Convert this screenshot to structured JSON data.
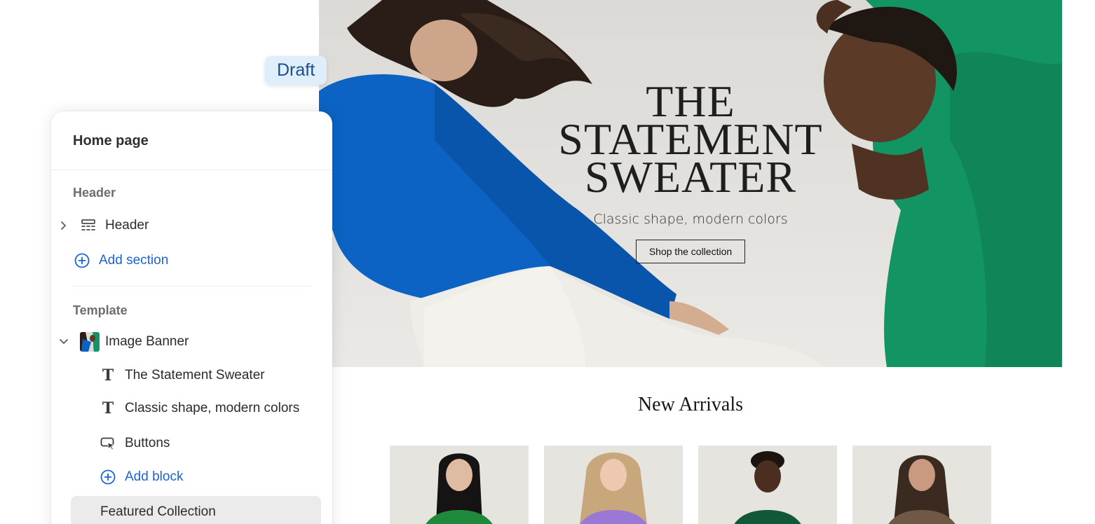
{
  "editor": {
    "status_badge": "Draft",
    "panel_title": "Home page",
    "header_group": {
      "label": "Header",
      "section_label": "Header",
      "add_section_label": "Add section"
    },
    "template_group": {
      "label": "Template",
      "section_label": "Image Banner",
      "blocks": [
        {
          "label": "The Statement Sweater",
          "icon": "text-icon"
        },
        {
          "label": "Classic shape, modern colors",
          "icon": "text-icon"
        },
        {
          "label": "Buttons",
          "icon": "button-cursor-icon"
        }
      ],
      "add_block_label": "Add block",
      "next_section_label": "Featured Collection"
    }
  },
  "preview": {
    "hero": {
      "title_line1": "THE",
      "title_line2": "STATEMENT",
      "title_line3": "SWEATER",
      "subtitle": "Classic shape, modern colors",
      "button_label": "Shop the collection"
    },
    "arrivals": {
      "title": "New Arrivals",
      "products": [
        {
          "sweater_color": "#1f8a3c"
        },
        {
          "sweater_color": "#9a78d6"
        },
        {
          "sweater_color": "#13573a"
        },
        {
          "sweater_color": "#6f5845"
        }
      ]
    }
  },
  "colors": {
    "accent_link": "#1b63d6",
    "draft_badge_bg": "#dfeefb",
    "blue_sweater": "#0c63c4",
    "green_sweater": "#129463"
  }
}
